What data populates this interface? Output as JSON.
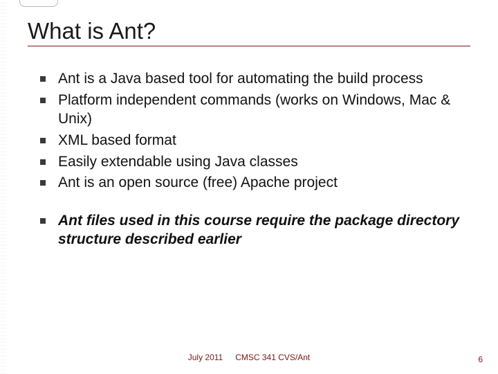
{
  "title": "What is Ant?",
  "bullets": [
    {
      "text": "Ant is a Java based tool for automating the build process",
      "emphasis": false,
      "gap_before": false
    },
    {
      "text": "Platform independent commands (works on Windows, Mac & Unix)",
      "emphasis": false,
      "gap_before": false
    },
    {
      "text": "XML based format",
      "emphasis": false,
      "gap_before": false
    },
    {
      "text": "Easily extendable using Java classes",
      "emphasis": false,
      "gap_before": false
    },
    {
      "text": "Ant is an open source (free) Apache project",
      "emphasis": false,
      "gap_before": false
    },
    {
      "text": "Ant files used in this course require the package directory structure described earlier",
      "emphasis": true,
      "gap_before": true
    }
  ],
  "footer": {
    "date": "July 2011",
    "course": "CMSC 341 CVS/Ant"
  },
  "page_number": "6",
  "colors": {
    "accent": "#7a1616"
  }
}
